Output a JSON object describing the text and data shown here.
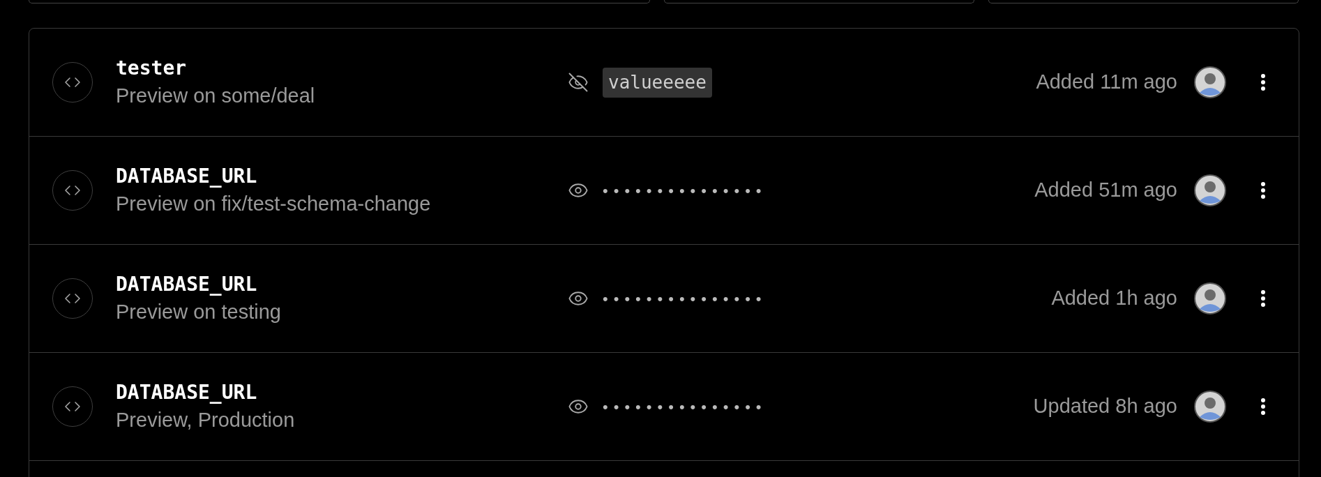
{
  "variables": [
    {
      "name": "tester",
      "scope": "Preview on some/deal",
      "revealed": true,
      "value": "valueeeee",
      "updated": "Added 11m ago"
    },
    {
      "name": "DATABASE_URL",
      "scope": "Preview on fix/test-schema-change",
      "revealed": false,
      "value": "•••••••••••••••",
      "updated": "Added 51m ago"
    },
    {
      "name": "DATABASE_URL",
      "scope": "Preview on testing",
      "revealed": false,
      "value": "•••••••••••••••",
      "updated": "Added 1h ago"
    },
    {
      "name": "DATABASE_URL",
      "scope": "Preview, Production",
      "revealed": false,
      "value": "•••••••••••••••",
      "updated": "Updated 8h ago"
    }
  ]
}
